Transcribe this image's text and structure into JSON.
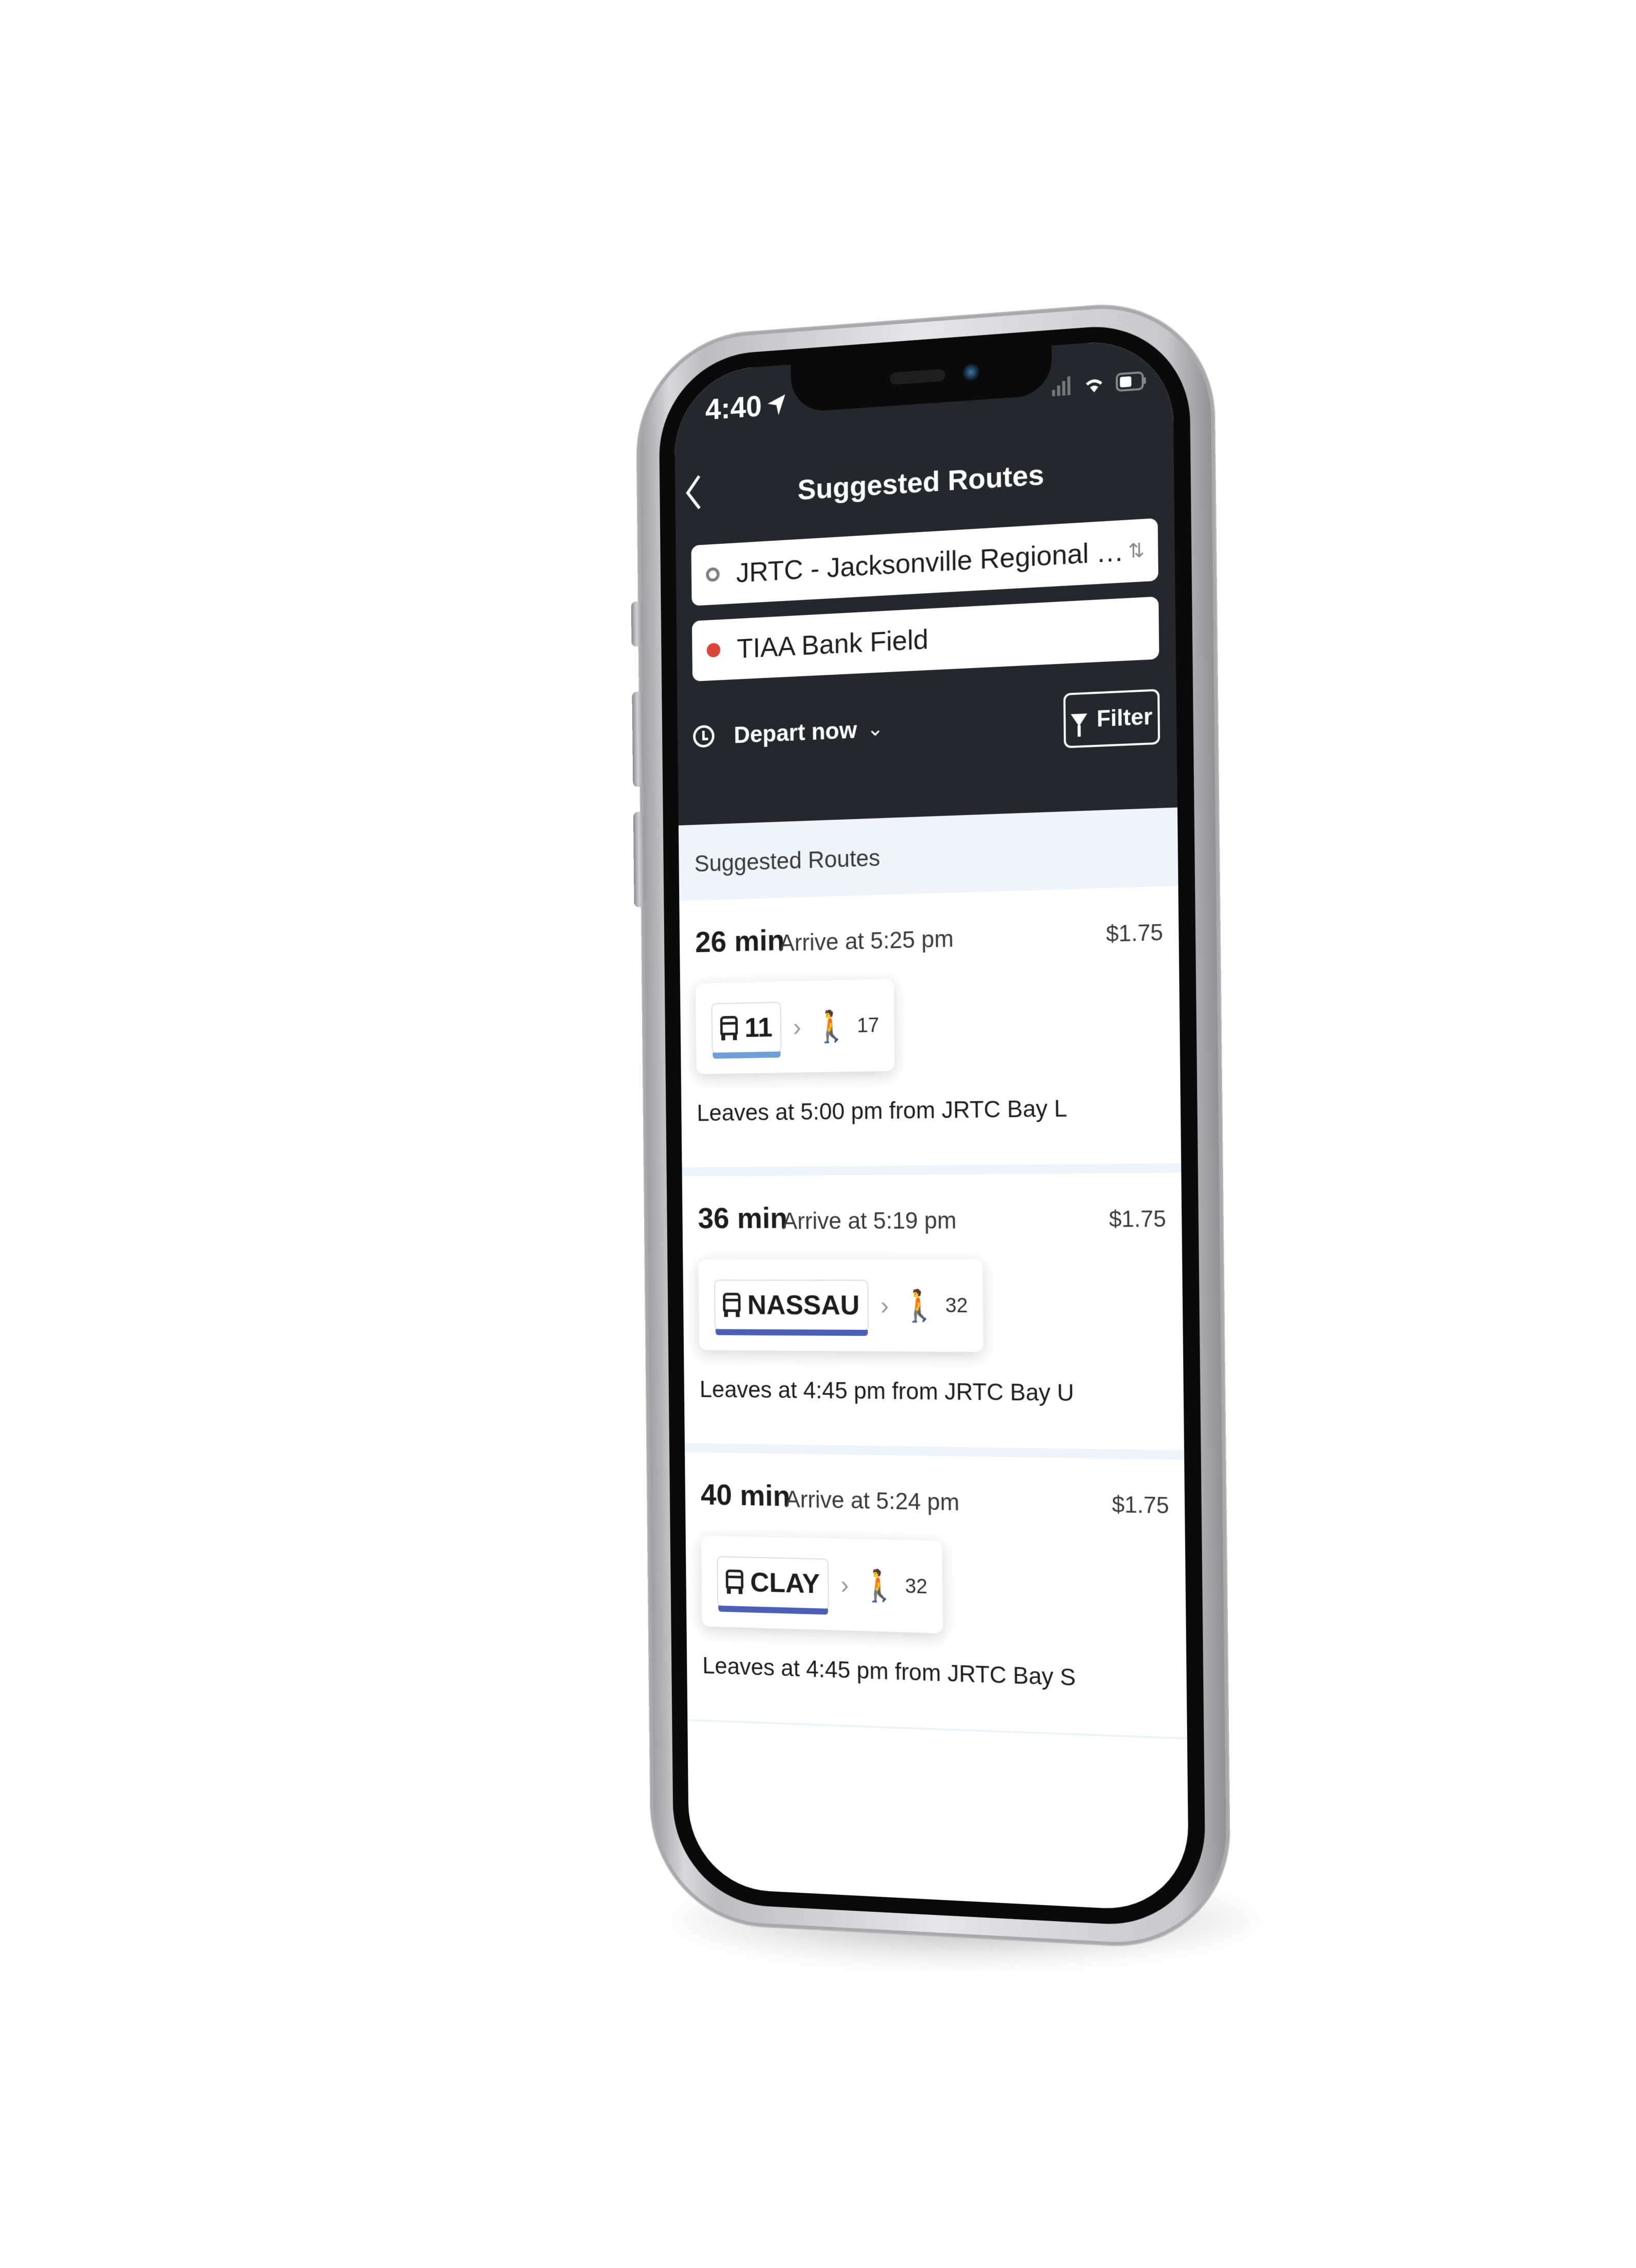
{
  "status_bar": {
    "time": "4:40",
    "location_icon": "location-arrow-icon",
    "signal_icon": "signal-icon",
    "wifi_icon": "wifi-icon",
    "battery_icon": "battery-icon"
  },
  "nav": {
    "back_icon": "chevron-left-icon",
    "title": "Suggested Routes"
  },
  "trip": {
    "origin": "JRTC - Jacksonville Regional Transportation Center",
    "origin_display": "JRTC - Jacksonville Regional Transp...",
    "destination": "TIAA Bank Field",
    "swap_icon": "swap-vertical-icon",
    "origin_color": "#808080",
    "destination_color": "#d9453b"
  },
  "controls": {
    "depart_label": "Depart now",
    "filter_label": "Filter"
  },
  "section_label": "Suggested Routes",
  "routes": [
    {
      "duration": "26 min",
      "arrive": "Arrive at 5:25 pm",
      "price": "$1.75",
      "route": "11",
      "route_color": "#6f9fd8",
      "walk_minutes": "17",
      "leaves": "Leaves at 5:00 pm from JRTC Bay L"
    },
    {
      "duration": "36 min",
      "arrive": "Arrive at 5:19 pm",
      "price": "$1.75",
      "route": "NASSAU",
      "route_color": "#4a5fb5",
      "walk_minutes": "32",
      "leaves": "Leaves at 4:45 pm from JRTC Bay U"
    },
    {
      "duration": "40 min",
      "arrive": "Arrive at 5:24 pm",
      "price": "$1.75",
      "route": "CLAY",
      "route_color": "#4a5fb5",
      "walk_minutes": "32",
      "leaves": "Leaves at 4:45 pm from JRTC Bay S"
    }
  ],
  "colors": {
    "header_bg": "#26272c",
    "section_bg": "#edf4fa"
  }
}
